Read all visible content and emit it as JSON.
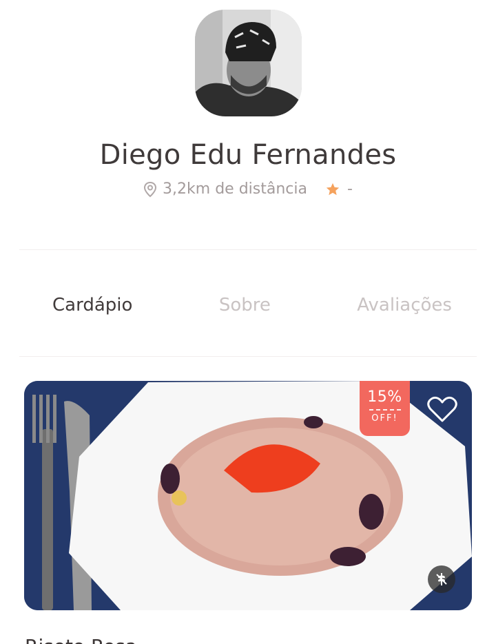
{
  "profile": {
    "name": "Diego Edu Fernandes",
    "distance": "3,2km de distância",
    "rating": "-"
  },
  "tabs": [
    {
      "label": "Cardápio",
      "active": true
    },
    {
      "label": "Sobre",
      "active": false
    },
    {
      "label": "Avaliações",
      "active": false
    }
  ],
  "dish": {
    "discount_value": "15%",
    "discount_label": "OFF!",
    "title": "Risoto Rosa",
    "favorite": false,
    "gluten_free": true
  },
  "colors": {
    "accent": "#f2685e",
    "star": "#f5a25d",
    "text": "#403a3a",
    "muted": "#a39b9b"
  },
  "icons": [
    "location-pin-icon",
    "star-icon",
    "heart-icon",
    "gluten-free-icon"
  ]
}
